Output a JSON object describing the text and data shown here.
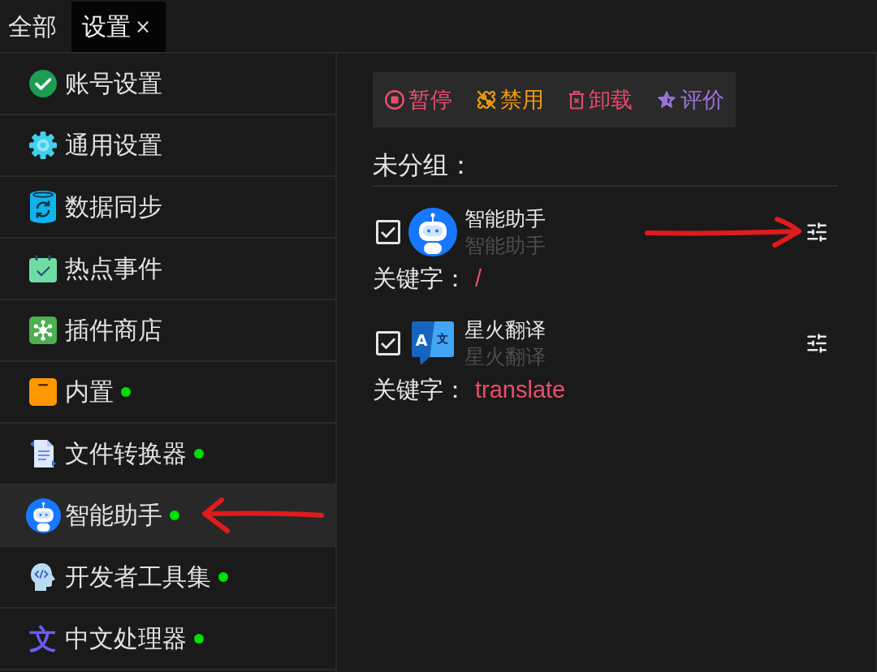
{
  "tabs": [
    {
      "label": "全部",
      "selected": false
    },
    {
      "label": "设置",
      "selected": true,
      "close": "×"
    }
  ],
  "sidebar": {
    "items": [
      {
        "label": "账号设置",
        "kind": "account",
        "selected": false,
        "status_dot": false,
        "annotated": false
      },
      {
        "label": "通用设置",
        "kind": "general",
        "selected": false,
        "status_dot": false,
        "annotated": false
      },
      {
        "label": "数据同步",
        "kind": "sync",
        "selected": false,
        "status_dot": false,
        "annotated": false
      },
      {
        "label": "热点事件",
        "kind": "events",
        "selected": false,
        "status_dot": false,
        "annotated": false
      },
      {
        "label": "插件商店",
        "kind": "store",
        "selected": false,
        "status_dot": false,
        "annotated": false
      },
      {
        "label": "内置",
        "kind": "builtin",
        "selected": false,
        "status_dot": true,
        "annotated": false
      },
      {
        "label": "文件转换器",
        "kind": "converter",
        "selected": false,
        "status_dot": true,
        "annotated": false
      },
      {
        "label": "智能助手",
        "kind": "assistant",
        "selected": true,
        "status_dot": true,
        "annotated": true
      },
      {
        "label": "开发者工具集",
        "kind": "devtools",
        "selected": false,
        "status_dot": true,
        "annotated": false
      },
      {
        "label": "中文处理器",
        "kind": "glyph",
        "glyph": "文",
        "selected": false,
        "status_dot": true,
        "annotated": false
      }
    ]
  },
  "toolbar": {
    "buttons": [
      {
        "label": "暂停",
        "kind": "pause",
        "color": "#e8506e"
      },
      {
        "label": "禁用",
        "kind": "disable",
        "color": "#f09a10"
      },
      {
        "label": "卸载",
        "kind": "uninstall",
        "color": "#e24a66"
      },
      {
        "label": "评价",
        "kind": "rate",
        "color": "#9a72d8"
      }
    ]
  },
  "group": {
    "title": "未分组：",
    "plugins": [
      {
        "checked": true,
        "kind": "assistant",
        "title": "智能助手",
        "subtitle": "智能助手",
        "keyword_label": "关键字：",
        "keyword": "/",
        "annotated": true
      },
      {
        "checked": true,
        "kind": "translate",
        "icon_letters": [
          "A",
          "文"
        ],
        "title": "星火翻译",
        "subtitle": "星火翻译",
        "keyword_label": "关键字：",
        "keyword": "translate",
        "annotated": false
      }
    ]
  }
}
